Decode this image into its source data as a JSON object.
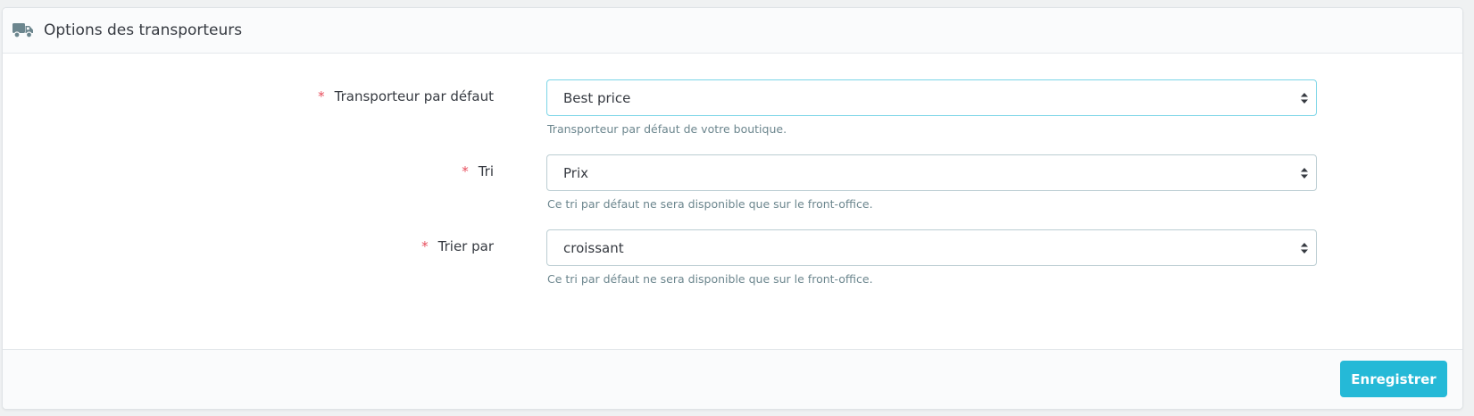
{
  "panel": {
    "title": "Options des transporteurs",
    "icon": "truck-icon"
  },
  "fields": [
    {
      "required_mark": "*",
      "label": "Transporteur par défaut",
      "value": "Best price",
      "help": "Transporteur par défaut de votre boutique."
    },
    {
      "required_mark": "*",
      "label": "Tri",
      "value": "Prix",
      "help": "Ce tri par défaut ne sera disponible que sur le front-office."
    },
    {
      "required_mark": "*",
      "label": "Trier par",
      "value": "croissant",
      "help": "Ce tri par défaut ne sera disponible que sur le front-office."
    }
  ],
  "footer": {
    "save_label": "Enregistrer"
  },
  "colors": {
    "accent": "#25b9d7",
    "required": "#e84e5d",
    "focus_border": "#7cd5e7",
    "help_text": "#6c868e"
  }
}
